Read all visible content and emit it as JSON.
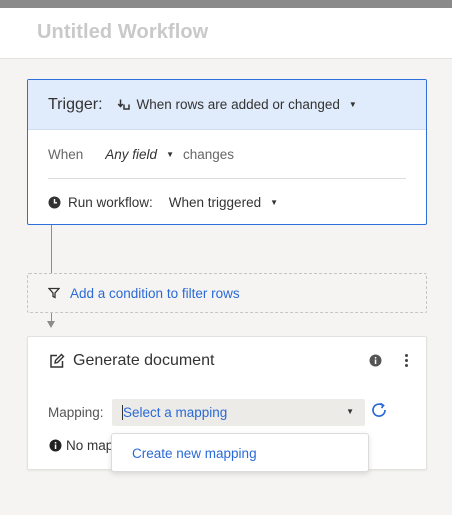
{
  "app": {
    "title": "Untitled Workflow"
  },
  "trigger": {
    "label": "Trigger:",
    "event": "When rows are added or changed",
    "when_label": "When",
    "field": "Any field",
    "changes_label": "changes",
    "run_label": "Run workflow:",
    "run_option": "When triggered"
  },
  "condition": {
    "link": "Add a condition to filter rows"
  },
  "action": {
    "title": "Generate document",
    "mapping_label": "Mapping:",
    "mapping_placeholder": "Select a mapping",
    "warning": "No map"
  },
  "dropdown": {
    "items": [
      "Create new mapping"
    ]
  },
  "colors": {
    "accent": "#2a6ad6",
    "trigger_bg": "#e0ebfb",
    "trigger_border": "#2f6fd9"
  },
  "icons": [
    "upload-icon",
    "clock-icon",
    "filter-icon",
    "edit-icon",
    "info-icon",
    "more-vertical-icon",
    "refresh-icon",
    "caret-down-icon"
  ]
}
